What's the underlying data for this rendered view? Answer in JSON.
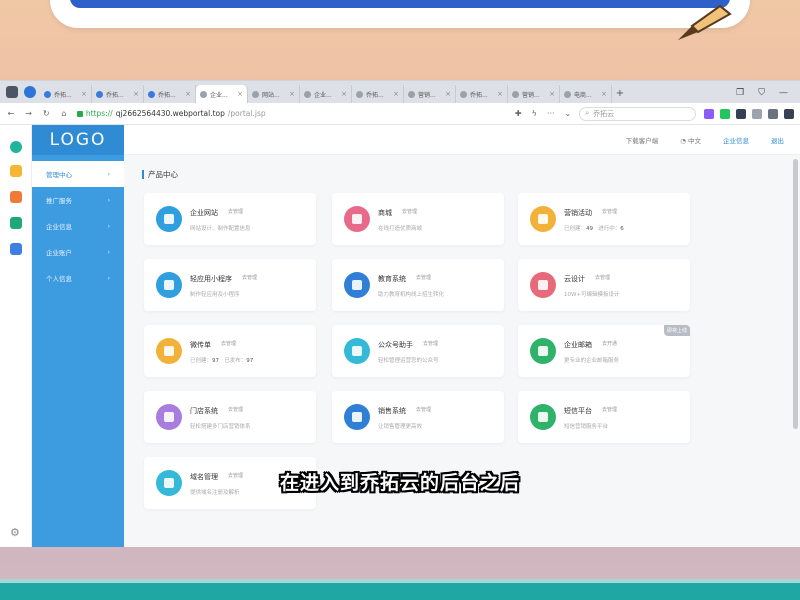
{
  "browser": {
    "tabs": [
      {
        "label": "乔拓..."
      },
      {
        "label": "乔拓..."
      },
      {
        "label": "乔拓..."
      },
      {
        "label": "企业..."
      },
      {
        "label": "网站..."
      },
      {
        "label": "企业..."
      },
      {
        "label": "乔拓..."
      },
      {
        "label": "营销..."
      },
      {
        "label": "乔拓..."
      },
      {
        "label": "营销..."
      },
      {
        "label": "电商..."
      }
    ],
    "url": {
      "scheme": "https://",
      "host": "qj2662564430.webportal.top",
      "path": "/portal.jsp"
    },
    "search_placeholder": "乔拓云"
  },
  "app": {
    "logo": "LOGO",
    "nav": [
      {
        "label": "管理中心",
        "active": true
      },
      {
        "label": "推广服务"
      },
      {
        "label": "企业信息"
      },
      {
        "label": "企业账户"
      },
      {
        "label": "个人信息"
      }
    ],
    "header": {
      "download": "下载客户端",
      "lang": "中文",
      "company": "企业信息",
      "logout": "退出"
    },
    "section_title": "产品中心",
    "products": [
      {
        "name": "企业网站",
        "tag": "去管理",
        "desc": "网站设计、制作配置信息",
        "color": "#2f9fe0"
      },
      {
        "name": "商城",
        "tag": "去管理",
        "desc": "在线打造优质商城",
        "color": "#e86a8a"
      },
      {
        "name": "营销活动",
        "tag": "去管理",
        "desc_pre": "已创建：",
        "desc_val1": "49",
        "desc_mid": "进行中：",
        "desc_val2": "6",
        "color": "#f2b23a"
      },
      {
        "name": "轻应用小程序",
        "tag": "去管理",
        "desc": "制作轻应用及小程序",
        "color": "#2f9fe0"
      },
      {
        "name": "教育系统",
        "tag": "去管理",
        "desc": "助力教育机构线上招生转化",
        "color": "#2f7fd6"
      },
      {
        "name": "云设计",
        "tag": "去管理",
        "desc": "10W+可编辑模板设计",
        "color": "#e86a7a"
      },
      {
        "name": "微传单",
        "tag": "去管理",
        "desc_pre": "已创建：",
        "desc_val1": "97",
        "desc_mid": "已发布：",
        "desc_val2": "97",
        "color": "#f2b23a"
      },
      {
        "name": "公众号助手",
        "tag": "去管理",
        "desc": "轻松管理运营您的公众号",
        "color": "#35b9d8"
      },
      {
        "name": "企业邮箱",
        "tag": "去开通",
        "desc": "更专业的企业邮箱服务",
        "color": "#2fb36a",
        "flag": "即将上线"
      },
      {
        "name": "门店系统",
        "tag": "去管理",
        "desc": "轻松搭建多门店营销体系",
        "color": "#a77de0"
      },
      {
        "name": "销售系统",
        "tag": "去管理",
        "desc": "让销售管理更高效",
        "color": "#2f7fd6"
      },
      {
        "name": "短信平台",
        "tag": "去管理",
        "desc": "短信营销服务平台",
        "color": "#2fb36a"
      },
      {
        "name": "域名管理",
        "tag": "去管理",
        "desc": "提供域名注册及解析",
        "color": "#35b9d8"
      }
    ]
  },
  "subtitle": "在进入到乔拓云的后台之后"
}
